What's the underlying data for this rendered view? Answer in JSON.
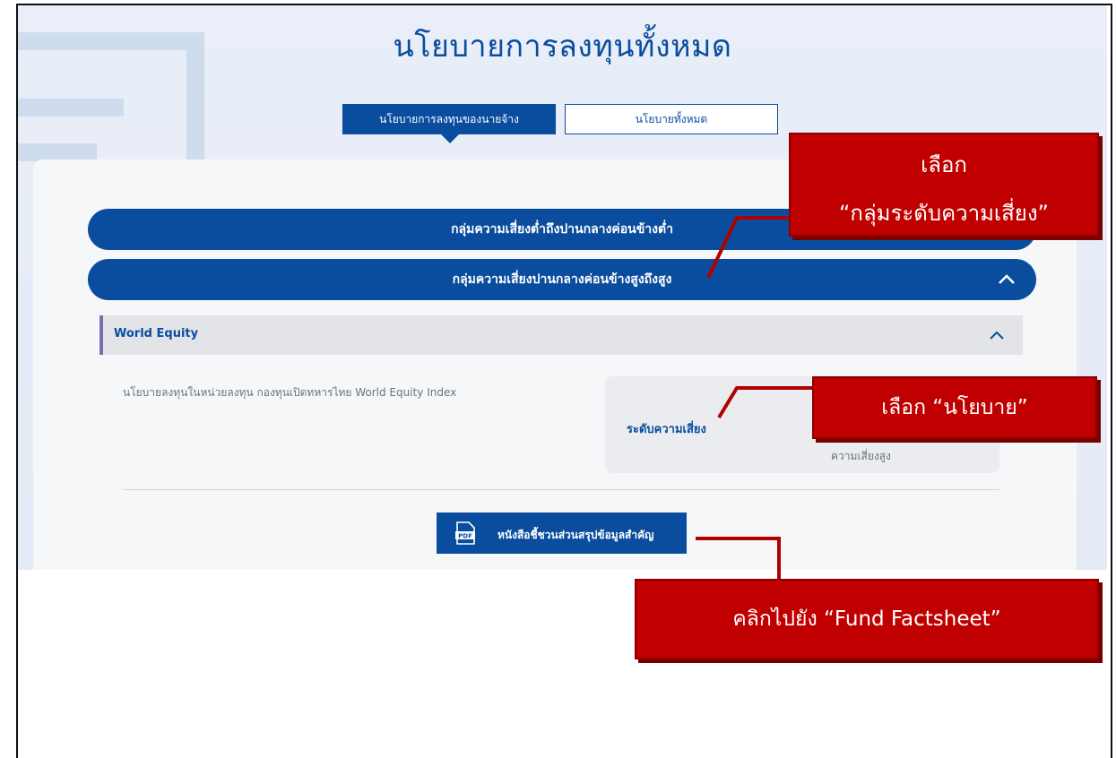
{
  "page": {
    "title": "นโยบายการลงทุนทั้งหมด",
    "tabs": [
      {
        "label": "นโยบายการลงทุนของนายจ้าง",
        "active": true
      },
      {
        "label": "นโยบายทั้งหมด",
        "active": false
      }
    ]
  },
  "risk_groups": [
    {
      "label": "กลุ่มความเสี่ยงต่ำถึงปานกลางค่อนข้างต่ำ",
      "expanded": false
    },
    {
      "label": "กลุ่มความเสี่ยงปานกลางค่อนข้างสูงถึงสูง",
      "expanded": true
    }
  ],
  "fund": {
    "name": "World Equity",
    "description": "นโยบายลงทุนในหน่วยลงทุน กองทุนเปิดทหารไทย World Equity Index",
    "risk_label": "ระดับความเสี่ยง",
    "risk_value": "ความเสี่ยงสูง",
    "pdf_button": "หนังสือชี้ชวนส่วนสรุปข้อมูลสำคัญ",
    "pdf_icon_text": "PDF"
  },
  "annotations": {
    "select_group_line1": "เลือก",
    "select_group_line2": "“กลุ่มระดับความเสี่ยง”",
    "select_policy": "เลือก “นโยบาย”",
    "click_factsheet": "คลิกไปยัง “Fund Factsheet”"
  },
  "colors": {
    "primary": "#0a4d9e",
    "annotation_red": "#c00000",
    "background": "#e9eef8"
  }
}
